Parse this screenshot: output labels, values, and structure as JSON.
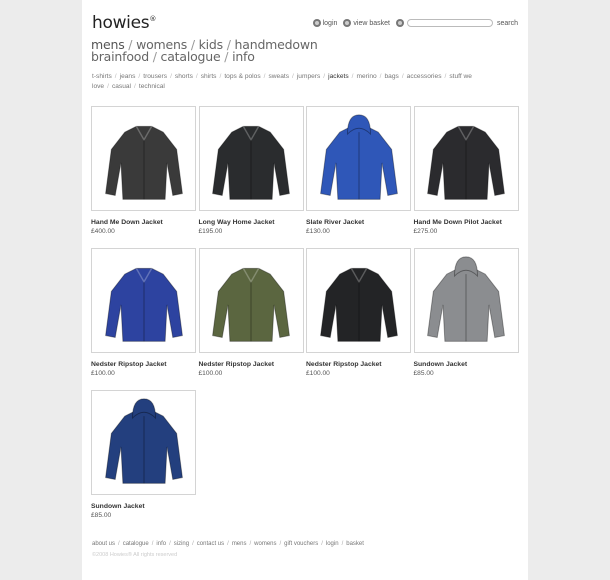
{
  "brand": {
    "name": "howies",
    "mark": "®"
  },
  "header": {
    "login": "login",
    "basket": "view basket",
    "search_label": "search"
  },
  "mainnav": [
    {
      "label": "mens",
      "active": true
    },
    {
      "label": "womens"
    },
    {
      "label": "kids"
    },
    {
      "label": "handmedown"
    },
    {
      "label": "brainfood"
    },
    {
      "label": "catalogue"
    },
    {
      "label": "info"
    }
  ],
  "categories": [
    "t-shirts",
    "jeans",
    "trousers",
    "shorts",
    "shirts",
    "tops & polos",
    "sweats",
    "jumpers",
    "jackets",
    "merino",
    "bags",
    "accessories",
    "stuff we love",
    "casual",
    "technical"
  ],
  "selected_category": "jackets",
  "products": [
    {
      "name": "Hand Me Down Jacket",
      "price": "£400.00",
      "color": "#3a3a3a",
      "hood": false
    },
    {
      "name": "Long Way Home Jacket",
      "price": "£195.00",
      "color": "#2a2c2e",
      "hood": false
    },
    {
      "name": "Slate River Jacket",
      "price": "£130.00",
      "color": "#2f57b8",
      "hood": true
    },
    {
      "name": "Hand Me Down Pilot Jacket",
      "price": "£275.00",
      "color": "#2b2b2e",
      "hood": false
    },
    {
      "name": "Nedster Ripstop Jacket",
      "price": "£100.00",
      "color": "#2d43a0",
      "hood": false
    },
    {
      "name": "Nedster Ripstop Jacket",
      "price": "£100.00",
      "color": "#5b6640",
      "hood": false
    },
    {
      "name": "Nedster Ripstop Jacket",
      "price": "£100.00",
      "color": "#232426",
      "hood": false
    },
    {
      "name": "Sundown Jacket",
      "price": "£85.00",
      "color": "#8b8d90",
      "hood": true
    },
    {
      "name": "Sundown Jacket",
      "price": "£85.00",
      "color": "#233f7e",
      "hood": true
    }
  ],
  "footer": [
    "about us",
    "catalogue",
    "info",
    "sizing",
    "contact us",
    "mens",
    "womens",
    "gift vouchers",
    "login",
    "basket"
  ],
  "copyright": "©2008 Howies® All rights reserved"
}
